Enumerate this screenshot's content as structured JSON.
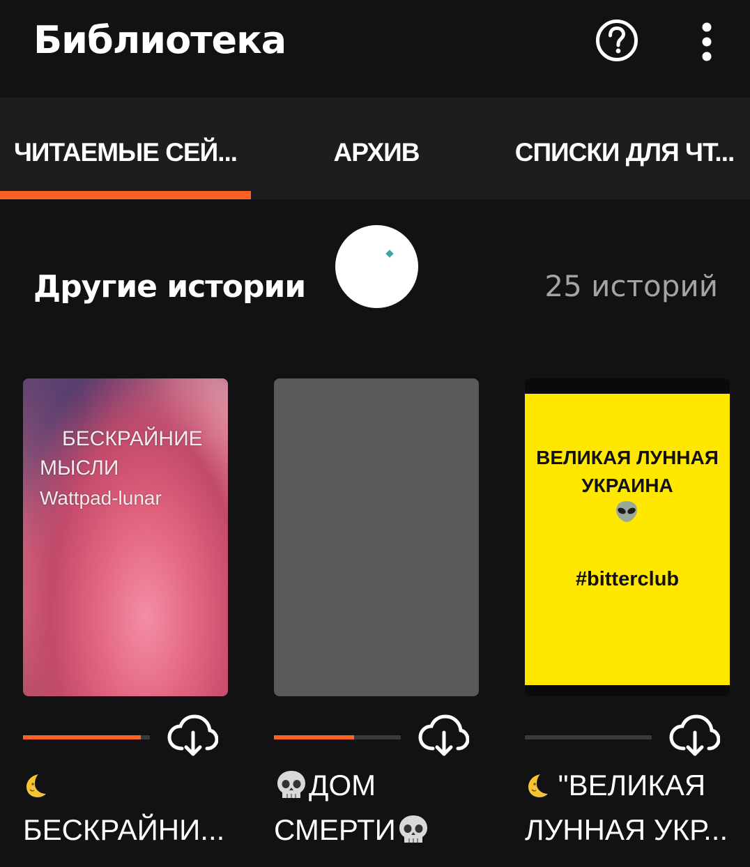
{
  "appbar": {
    "title": "Библиотека",
    "help_icon": "help-icon",
    "menu_icon": "more-vertical-icon"
  },
  "tabs": [
    {
      "label": "ЧИТАЕМЫЕ СЕЙ...",
      "active": true
    },
    {
      "label": "АРХИВ",
      "active": false
    },
    {
      "label": "СПИСКИ ДЛЯ ЧТ...",
      "active": false
    }
  ],
  "accent_color": "#ff6122",
  "section": {
    "title": "Другие истории",
    "count": "25 историй"
  },
  "stories": [
    {
      "cover_lines": [
        "БЕСКРАЙНИЕ",
        "МЫСЛИ",
        "Wattpad-lunar"
      ],
      "title_line1_emoji": "moon",
      "title_line2": "БЕСКРАЙНИ...",
      "progress": 0.93
    },
    {
      "title_line1": "ДОМ",
      "title_line2": "СМЕРТИ",
      "progress": 0.63
    },
    {
      "cover_title_line1": "ВЕЛИКАЯ ЛУННАЯ",
      "cover_title_line2": "УКРАИНА",
      "cover_tag": "#bitterclub",
      "title_line1": "\"ВЕЛИКАЯ",
      "title_line2": "ЛУННАЯ УКР...",
      "progress": 0.0
    }
  ]
}
